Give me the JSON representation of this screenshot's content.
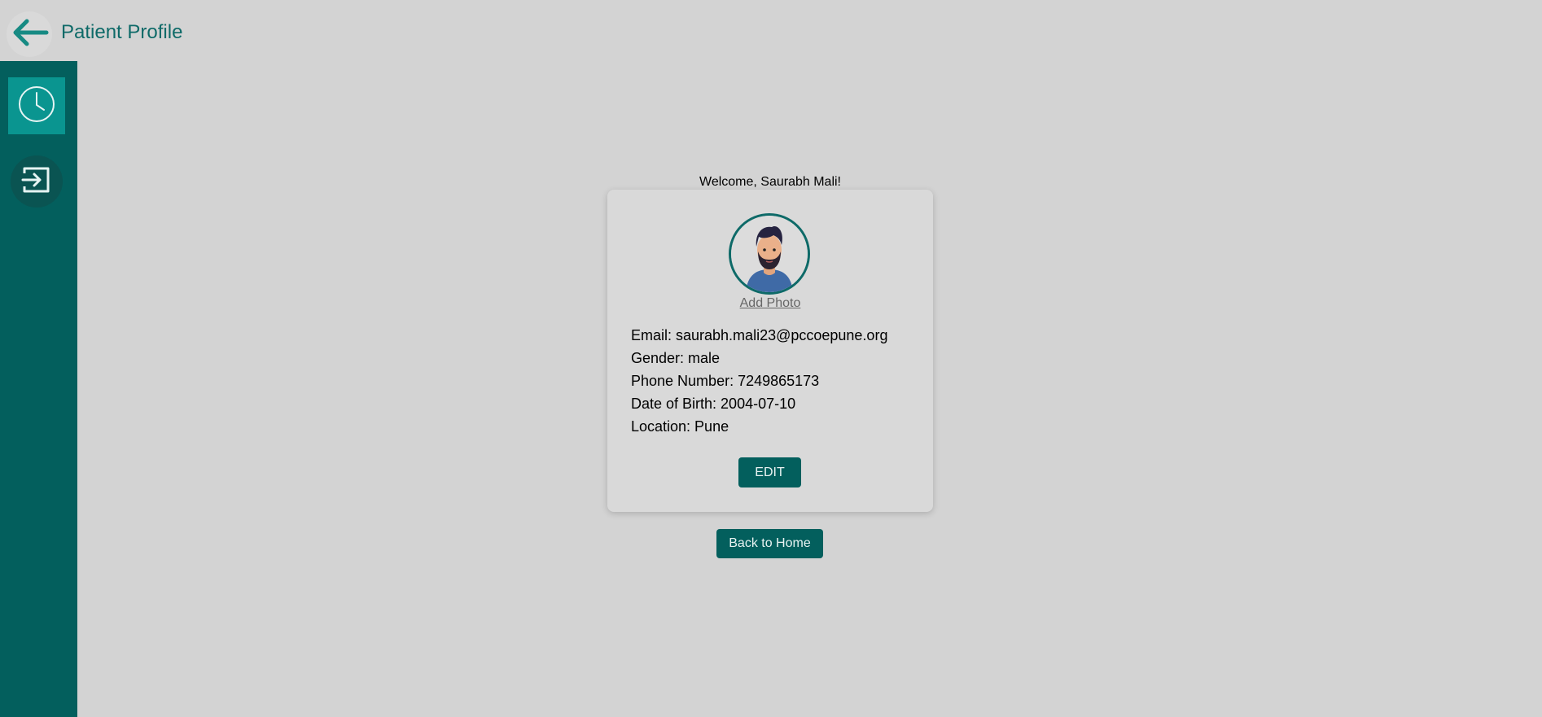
{
  "header": {
    "title": "Patient Profile",
    "back_icon": "arrow-left-icon"
  },
  "sidebar": {
    "items": [
      {
        "name": "history",
        "icon": "clock-icon"
      },
      {
        "name": "logout",
        "icon": "logout-icon"
      }
    ]
  },
  "profile": {
    "welcome": "Welcome, Saurabh Mali!",
    "avatar_icon": "user-avatar",
    "add_photo_label": "Add Photo",
    "email": "Email: saurabh.mali23@pccoepune.org",
    "gender": "Gender: male",
    "phone": "Phone Number: 7249865173",
    "dob": "Date of Birth: 2004-07-10",
    "location": "Location: Pune",
    "edit_label": "EDIT"
  },
  "actions": {
    "back_home_label": "Back to Home"
  },
  "colors": {
    "primary": "#035f5d",
    "accent": "#0a9590",
    "title": "#0e6a68",
    "background": "#d3d3d3"
  }
}
